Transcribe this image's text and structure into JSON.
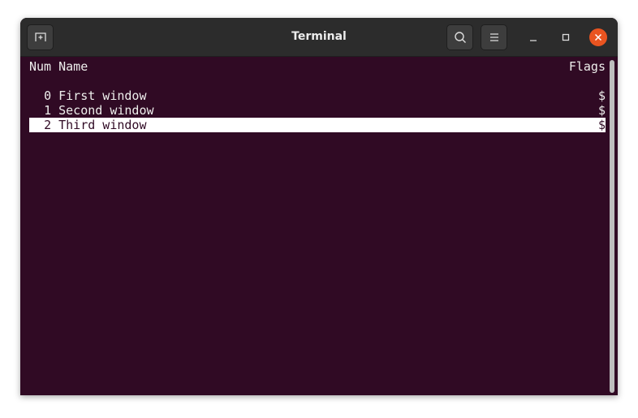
{
  "window": {
    "title": "Terminal"
  },
  "header_buttons": {
    "new_tab": "new-tab-icon",
    "search": "search-icon",
    "menu": "hamburger-menu-icon"
  },
  "terminal": {
    "columns": {
      "num": "Num",
      "name": "Name",
      "flags": "Flags"
    },
    "rows": [
      {
        "num": "0",
        "name": "First window",
        "flags": "$",
        "selected": false
      },
      {
        "num": "1",
        "name": "Second window",
        "flags": "$",
        "selected": false
      },
      {
        "num": "2",
        "name": "Third window",
        "flags": "$",
        "selected": true
      }
    ]
  },
  "colors": {
    "terminal_bg": "#300a24",
    "close": "#e95420"
  }
}
